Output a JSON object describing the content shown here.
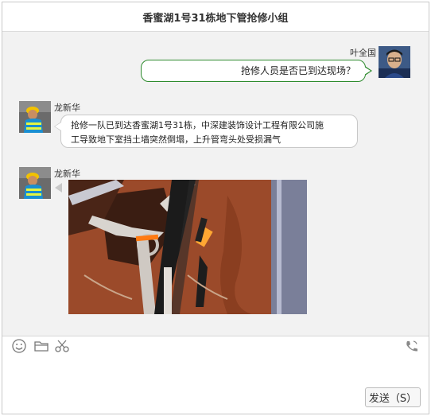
{
  "window": {
    "title": "香蜜湖1号31栋地下管抢修小组"
  },
  "messages": [
    {
      "sender": "叶全国",
      "side": "right",
      "text": "抢修人员是否已到达现场？"
    },
    {
      "sender": "龙新华",
      "side": "left",
      "text_line1": "抢修一队已到达香蜜湖1号31栋，中深建装饰设计工程有限公司施",
      "text_line2": "工导致地下室挡土墙突然倒塌，上升管弯头处受损漏气"
    },
    {
      "sender": "龙新华",
      "side": "left",
      "attachment": "photo"
    }
  ],
  "toolbar": {
    "icons": [
      "smiley-icon",
      "folder-icon",
      "scissors-icon",
      "phone-icon"
    ]
  },
  "composer": {
    "send_label": "发送（S）"
  },
  "colors": {
    "bubble_right_border": "#2e8b2e",
    "chat_background": "#f2f2f2"
  }
}
